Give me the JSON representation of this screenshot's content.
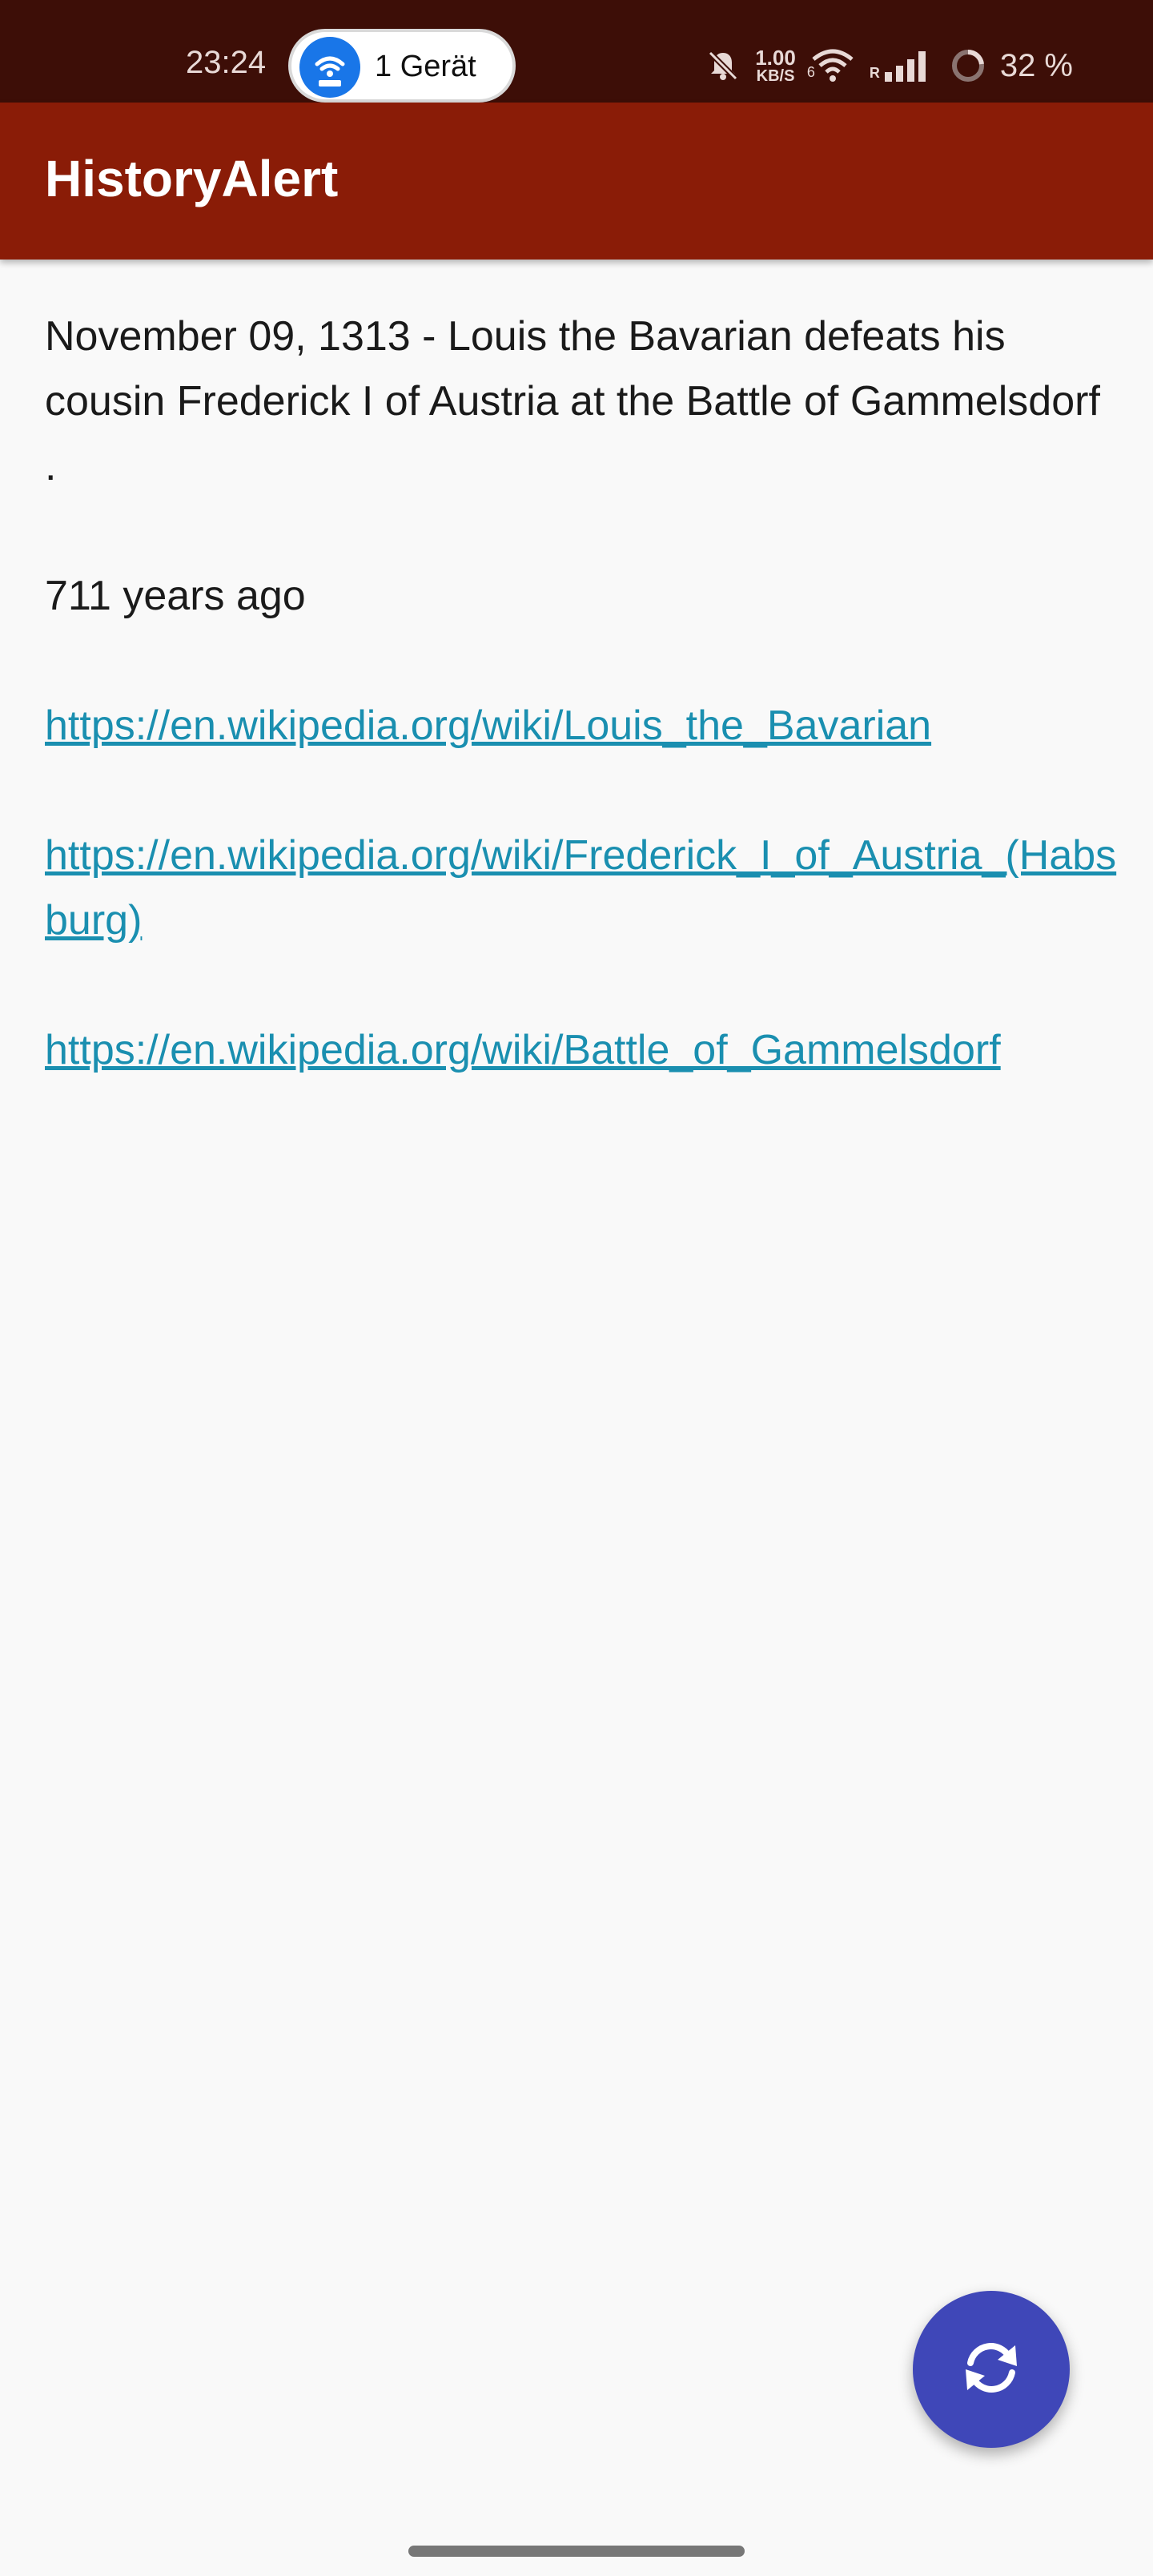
{
  "status_bar": {
    "time": "23:24",
    "hotspot_label": "1 Gerät",
    "net_speed_value": "1.00",
    "net_speed_unit": "KB/S",
    "wifi_badge": "6",
    "signal_badge": "R",
    "battery_percent": "32 %",
    "icons": [
      "hotspot-icon",
      "mute-icon",
      "wifi-icon",
      "signal-icon",
      "battery-icon"
    ]
  },
  "app_bar": {
    "title": "HistoryAlert"
  },
  "event": {
    "description": "November 09, 1313 - Louis the Bavarian defeats his cousin Frederick I of Austria at the Battle of Gammelsdorf .",
    "years_ago": "711 years ago",
    "links": [
      "https://en.wikipedia.org/wiki/Louis_the_Bavarian",
      "https://en.wikipedia.org/wiki/Frederick_I_of_Austria_(Habsburg)",
      "https://en.wikipedia.org/wiki/Battle_of_Gammelsdorf"
    ]
  },
  "fab": {
    "icon": "refresh-icon"
  },
  "colors": {
    "status_bar_bg": "#3d0e07",
    "app_bar_bg": "#8a1c07",
    "link": "#1a8fb0",
    "fab_bg": "#3f47b8",
    "page_bg": "#f9f9f9"
  }
}
